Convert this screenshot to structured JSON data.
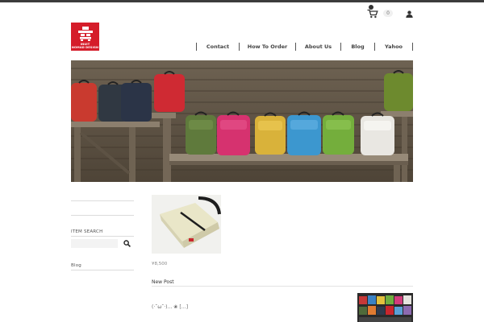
{
  "header": {
    "cart_count": "0",
    "logo_lines": [
      "INUIT",
      "NOMAD DESIGN"
    ]
  },
  "nav": {
    "items": [
      {
        "label": "Contact"
      },
      {
        "label": "How To Order"
      },
      {
        "label": "About Us"
      },
      {
        "label": "Blog"
      },
      {
        "label": "Yahoo"
      }
    ]
  },
  "sidebar": {
    "item_search_heading": "ITEM SEARCH",
    "search_placeholder": "",
    "blog_heading": "Blog"
  },
  "main": {
    "product_price": "¥8,500",
    "new_post_heading": "New Post",
    "post_excerpt": "(·˘ω˘·)…  ❀ […]"
  },
  "colors": {
    "logo_red": "#d51d2a",
    "topbar": "#3c3c3c"
  },
  "icons": [
    "cart-icon",
    "user-icon",
    "search-icon"
  ]
}
